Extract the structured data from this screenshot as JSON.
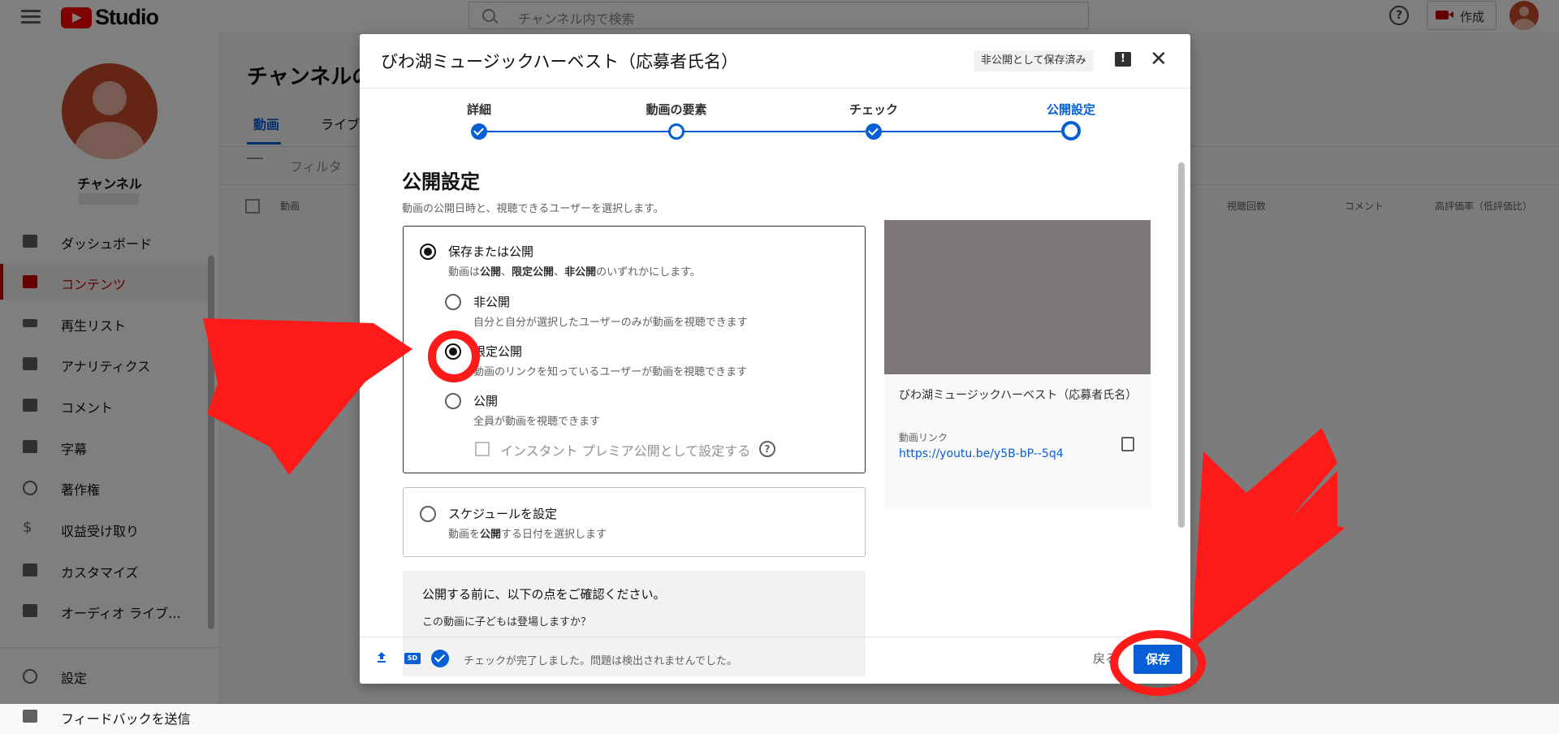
{
  "app": {
    "logo_text": "Studio",
    "search_placeholder": "チャンネル内で検索",
    "help_icon": "?",
    "create_label": "作成"
  },
  "sidebar": {
    "channel_label": "チャンネル",
    "items": [
      {
        "label": "ダッシュボード",
        "icon": "dashboard-icon"
      },
      {
        "label": "コンテンツ",
        "icon": "content-icon",
        "active": true
      },
      {
        "label": "再生リスト",
        "icon": "playlist-icon"
      },
      {
        "label": "アナリティクス",
        "icon": "analytics-icon"
      },
      {
        "label": "コメント",
        "icon": "comment-icon"
      },
      {
        "label": "字幕",
        "icon": "subtitles-icon"
      },
      {
        "label": "著作権",
        "icon": "copyright-icon"
      },
      {
        "label": "収益受け取り",
        "icon": "dollar-icon"
      },
      {
        "label": "カスタマイズ",
        "icon": "wand-icon"
      },
      {
        "label": "オーディオ ライブ…",
        "icon": "audio-library-icon"
      }
    ],
    "settings_label": "設定",
    "feedback_label": "フィードバックを送信"
  },
  "main": {
    "title": "チャンネルの",
    "tabs": [
      "動画",
      "ライブ"
    ],
    "filter_label": "フィルタ",
    "columns": [
      "動画",
      "視聴回数",
      "コメント",
      "高評価率（低評価比）"
    ]
  },
  "dialog": {
    "title": "びわ湖ミュージックハーベスト（応募者氏名）",
    "saved_badge": "非公開として保存済み",
    "feedback_icon": "!",
    "close_icon": "✕",
    "steps": [
      {
        "label": "詳細",
        "state": "done"
      },
      {
        "label": "動画の要素",
        "state": "ring"
      },
      {
        "label": "チェック",
        "state": "done"
      },
      {
        "label": "公開設定",
        "state": "current"
      }
    ],
    "section_title": "公開設定",
    "section_desc": "動画の公開日時と、視聴できるユーザーを選択します。",
    "save_or_publish": {
      "label": "保存または公開",
      "desc_pre": "動画は",
      "desc_b1": "公開",
      "desc_sep1": "、",
      "desc_b2": "限定公開",
      "desc_sep2": "、",
      "desc_b3": "非公開",
      "desc_post": "のいずれかにします。",
      "options": [
        {
          "label": "非公開",
          "desc": "自分と自分が選択したユーザーのみが動画を視聴できます",
          "selected": false
        },
        {
          "label": "限定公開",
          "desc": "動画のリンクを知っているユーザーが動画を視聴できます",
          "selected": true
        },
        {
          "label": "公開",
          "desc": "全員が動画を視聴できます",
          "selected": false
        }
      ],
      "premiere_label": "インスタント プレミア公開として設定する",
      "premiere_help": "?"
    },
    "schedule": {
      "label": "スケジュールを設定",
      "desc_pre": "動画を",
      "desc_b": "公開",
      "desc_post": "する日付を選択します"
    },
    "before_publish": {
      "title": "公開する前に、以下の点をご確認ください。",
      "question": "この動画に子どもは登場しますか？"
    },
    "preview": {
      "title": "びわ湖ミュージックハーベスト（応募者氏名）",
      "link_label": "動画リンク",
      "link": "https://youtu.be/y5B-bP--5q4"
    },
    "footer": {
      "sd_badge": "SD",
      "status": "チェックが完了しました。問題は検出されませんでした。",
      "back_label": "戻る",
      "save_label": "保存"
    }
  },
  "colors": {
    "accent": "#065fd4",
    "annotation": "#ff1a1a",
    "brand": "#ff0000",
    "active_nav": "#cc0000"
  }
}
